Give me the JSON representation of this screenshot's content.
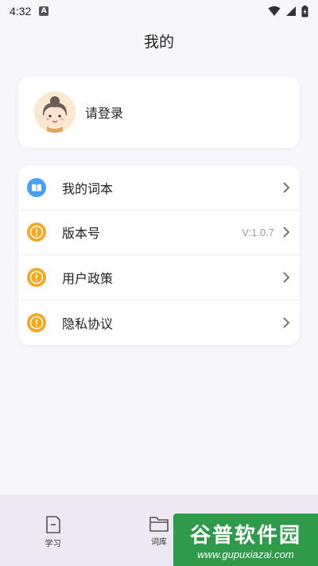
{
  "status_bar": {
    "time": "4:32",
    "notification_letter": "A"
  },
  "header": {
    "title": "我的"
  },
  "login": {
    "label": "请登录"
  },
  "menu": {
    "items": [
      {
        "label": "我的词本",
        "value": "",
        "icon": "book-icon"
      },
      {
        "label": "版本号",
        "value": "V:1.0.7",
        "icon": "warning-icon"
      },
      {
        "label": "用户政策",
        "value": "",
        "icon": "warning-icon"
      },
      {
        "label": "隐私协议",
        "value": "",
        "icon": "warning-icon"
      }
    ]
  },
  "bottom_nav": {
    "items": [
      {
        "label": "学习",
        "icon": "study-icon"
      },
      {
        "label": "词库",
        "icon": "folder-icon"
      },
      {
        "label": "",
        "icon": "profile-icon"
      }
    ]
  },
  "watermark": {
    "title": "谷普软件园",
    "url": "www.gupuxiazai.com"
  },
  "colors": {
    "background": "#f7f6fa",
    "accent_blue": "#4a9ff0",
    "accent_orange": "#f5a623",
    "nav_bg": "#ece9f5"
  }
}
